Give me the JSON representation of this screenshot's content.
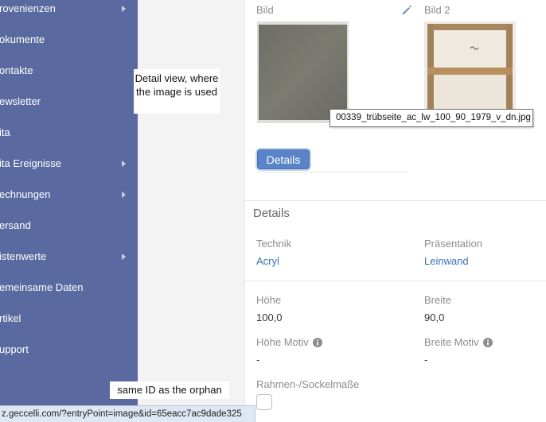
{
  "sidebar": {
    "items": [
      {
        "label": "rovenienzen",
        "has_submenu": true
      },
      {
        "label": "okumente",
        "has_submenu": false
      },
      {
        "label": "ontakte",
        "has_submenu": false
      },
      {
        "label": "ewsletter",
        "has_submenu": false
      },
      {
        "label": "ita",
        "has_submenu": false
      },
      {
        "label": "ita Ereignisse",
        "has_submenu": true
      },
      {
        "label": "echnungen",
        "has_submenu": true
      },
      {
        "label": "ersand",
        "has_submenu": false
      },
      {
        "label": "istenwerte",
        "has_submenu": true
      },
      {
        "label": "emeinsame Daten",
        "has_submenu": false
      },
      {
        "label": "rtikel",
        "has_submenu": false
      },
      {
        "label": "upport",
        "has_submenu": false
      }
    ]
  },
  "annotations": {
    "detail_view": "Detail view, where the image is used",
    "orphan_id": "same ID as the orphan"
  },
  "images": {
    "bild_label": "Bild",
    "bild2_label": "Bild 2",
    "tooltip": "00339_trübseite_ac_lw_100_90_1979_v_dn.jpg"
  },
  "details_button": {
    "label": "Details"
  },
  "details_section": {
    "title": "Details",
    "fields": {
      "technik": {
        "label": "Technik",
        "value": "Acryl"
      },
      "praesentation": {
        "label": "Präsentation",
        "value": "Leinwand"
      },
      "hoehe": {
        "label": "Höhe",
        "value": "100,0"
      },
      "breite": {
        "label": "Breite",
        "value": "90,0"
      },
      "hoehe_motiv": {
        "label": "Höhe Motiv",
        "value": "-"
      },
      "breite_motiv": {
        "label": "Breite Motiv",
        "value": "-"
      },
      "rahmen": {
        "label": "Rahmen-/Sockelmaße"
      }
    }
  },
  "statusbar": {
    "url": "z.geccelli.com/?entryPoint=image&id=65eacc7ac9dade325"
  },
  "colors": {
    "sidebar_bg": "#5a6aa0",
    "accent_link": "#3a73b5",
    "button_bg": "#5a84c8",
    "statusbar_bg": "#dfe7f4"
  },
  "icons": {
    "edit": "pencil-icon",
    "info": "info-icon",
    "submenu": "chevron-right-icon"
  }
}
